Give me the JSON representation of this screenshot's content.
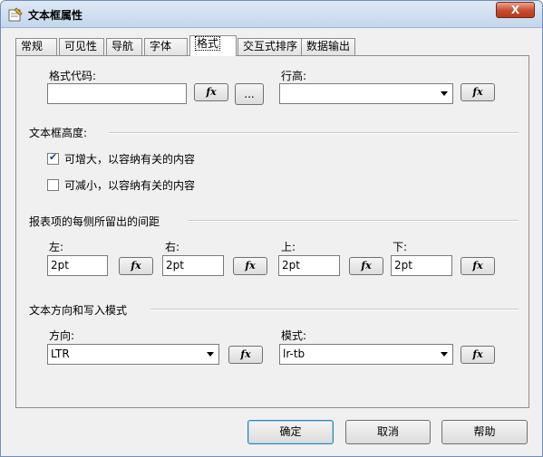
{
  "window": {
    "title": "文本框属性",
    "close_label": "X"
  },
  "tabs": [
    {
      "label": "常规"
    },
    {
      "label": "可见性"
    },
    {
      "label": "导航"
    },
    {
      "label": "字体"
    },
    {
      "label": "格式",
      "active": true
    },
    {
      "label": "交互式排序"
    },
    {
      "label": "数据输出"
    }
  ],
  "format": {
    "format_code_label": "格式代码:",
    "format_code_value": "",
    "fx_label": "fx",
    "ellipsis_label": "...",
    "line_height_label": "行高:",
    "line_height_value": ""
  },
  "height_section": {
    "title": "文本框高度:",
    "can_grow_label": "可增大，以容纳有关的内容",
    "can_grow_checked": true,
    "can_shrink_label": "可减小，以容纳有关的内容",
    "can_shrink_checked": false
  },
  "padding_section": {
    "title": "报表项的每侧所留出的间距",
    "left_label": "左:",
    "left_value": "2pt",
    "right_label": "右:",
    "right_value": "2pt",
    "top_label": "上:",
    "top_value": "2pt",
    "bottom_label": "下:",
    "bottom_value": "2pt"
  },
  "direction_section": {
    "title": "文本方向和写入模式",
    "direction_label": "方向:",
    "direction_value": "LTR",
    "mode_label": "模式:",
    "mode_value": "lr-tb"
  },
  "footer": {
    "ok_label": "确定",
    "cancel_label": "取消",
    "help_label": "帮助"
  }
}
